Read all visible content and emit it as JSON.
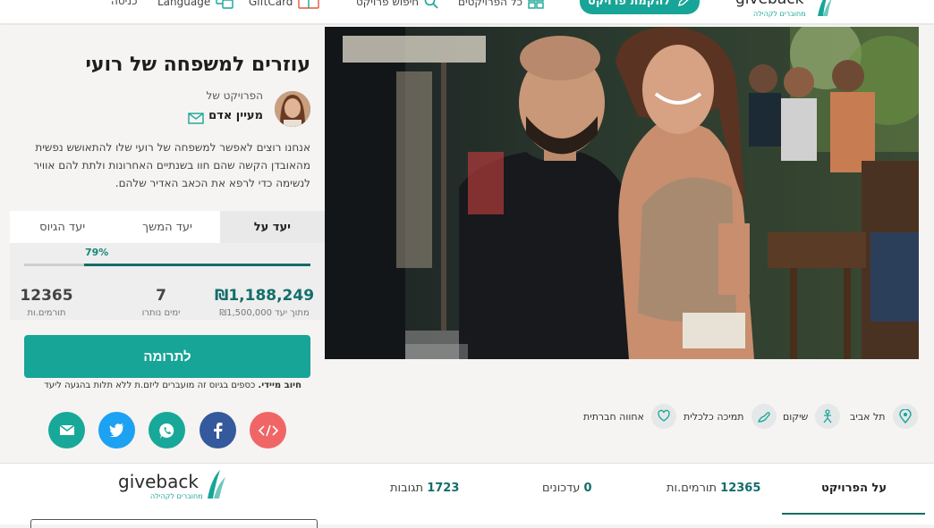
{
  "header": {
    "nav": {
      "account": "כניסה",
      "language": "Language",
      "giftcard": "GiftCard",
      "search_projects": "חיפוש פרויקט",
      "my_projects": "כל הפרויקטים"
    },
    "cta_label": "להקמת פרויקט",
    "logo_text": "giveback",
    "logo_tagline": "מחוברים לקהילה"
  },
  "project": {
    "title": "עוזרים למשפחה של רועי",
    "owner_label": "הפרויקט של",
    "owner_name": "מעיין אדם",
    "description": "אנחנו רוצים לאפשר למשפחה של רועי שלו להתאושש נפשית מהאובדן הקשה שהם חוו בשנתיים האחרונות ולתת להם אוויר לנשימה כדי לרפא את הכאב האדיר שלהם."
  },
  "goal_tabs": [
    {
      "label": "יעד על",
      "active": true
    },
    {
      "label": "יעד המשך",
      "active": false
    },
    {
      "label": "יעד הגיוס",
      "active": false
    }
  ],
  "progress": {
    "percent_label": "79%",
    "fraction": 0.79
  },
  "stats": {
    "raised": "₪1,188,249",
    "raised_sub": "מתוך יעד ₪1,500,000",
    "days_left": "7",
    "days_left_label": "ימים נותרו",
    "donors": "12365",
    "donors_label": "תורמים.ות"
  },
  "donate": {
    "button_label": "לתרומה",
    "note_bold": "חיוב מיידי.",
    "note_text": " כספים בגיוס זה מועברים ליזם.ת ללא תלות בהגעה ליעד"
  },
  "share": [
    "embed-code",
    "facebook",
    "whatsapp",
    "twitter",
    "email"
  ],
  "tags": [
    {
      "label": "תל אביב",
      "icon": "location-pin-icon"
    },
    {
      "label": "שיקום",
      "icon": "rehab-icon"
    },
    {
      "label": "תמיכה כלכלית",
      "icon": "financial-support-icon"
    },
    {
      "label": "אחווה חברתית",
      "icon": "social-solidarity-icon"
    }
  ],
  "bottom_tabs": {
    "about": "על הפרויקט",
    "donors_label": "תורמים.ות",
    "donors_count": "12365",
    "updates_label": "עדכונים",
    "updates_count": "0",
    "comments_label": "תגובות",
    "comments_count": "1723"
  },
  "colors": {
    "brand": "#17a597",
    "dark_teal": "#136e6b"
  }
}
